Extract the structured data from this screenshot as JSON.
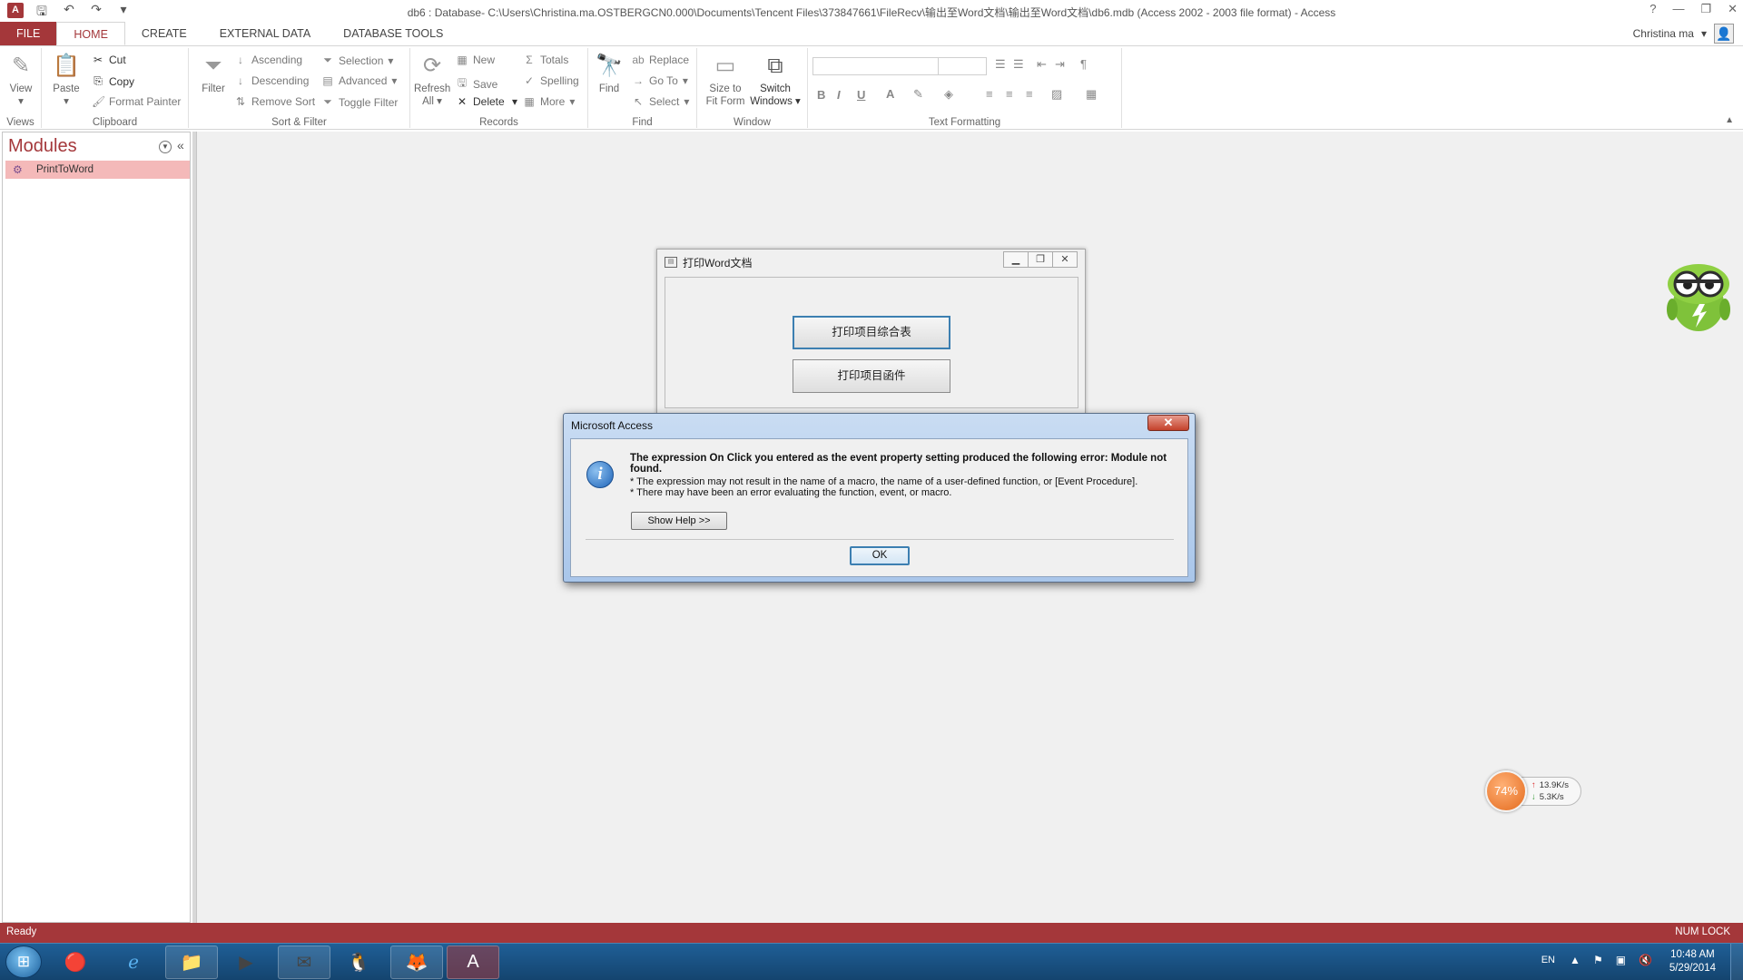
{
  "titlebar": {
    "app_icon": "A",
    "title": "db6 : Database- C:\\Users\\Christina.ma.OSTBERGCN0.000\\Documents\\Tencent Files\\373847661\\FileRecv\\输出至Word文档\\输出至Word文档\\db6.mdb (Access 2002 - 2003 file format) - Access",
    "help": "?",
    "minimize": "—",
    "restore": "❐",
    "close": "✕"
  },
  "tabs": [
    "FILE",
    "HOME",
    "CREATE",
    "EXTERNAL DATA",
    "DATABASE TOOLS"
  ],
  "user": {
    "name": "Christina ma"
  },
  "ribbon": {
    "views": {
      "label": "Views",
      "view": "View"
    },
    "clipboard": {
      "label": "Clipboard",
      "paste": "Paste",
      "cut": "Cut",
      "copy": "Copy",
      "format_painter": "Format Painter"
    },
    "sort_filter": {
      "label": "Sort & Filter",
      "filter": "Filter",
      "ascending": "Ascending",
      "descending": "Descending",
      "remove_sort": "Remove Sort",
      "selection": "Selection",
      "advanced": "Advanced",
      "toggle_filter": "Toggle Filter"
    },
    "records": {
      "label": "Records",
      "refresh": "Refresh",
      "refresh2": "All",
      "new": "New",
      "save": "Save",
      "delete": "Delete",
      "totals": "Totals",
      "spelling": "Spelling",
      "more": "More"
    },
    "find": {
      "label": "Find",
      "find": "Find",
      "replace": "Replace",
      "goto": "Go To",
      "select": "Select"
    },
    "window": {
      "label": "Window",
      "size_to_fit": "Size to",
      "size_to_fit2": "Fit Form",
      "switch": "Switch",
      "switch2": "Windows"
    },
    "text_formatting": {
      "label": "Text Formatting",
      "bold": "B",
      "italic": "I",
      "underline": "U"
    }
  },
  "navpane": {
    "title": "Modules",
    "items": [
      {
        "label": "PrintToWord"
      }
    ]
  },
  "form": {
    "title": "打印Word文档",
    "button1": "打印项目综合表",
    "button2": "打印项目函件"
  },
  "msgbox": {
    "title": "Microsoft Access",
    "close": "✕",
    "main": "The expression On Click you entered as the event property setting produced the following error: Module not found.",
    "line1": "* The expression may not result in the name of a macro, the name of a user-defined function, or [Event Procedure].",
    "line2": "* There may have been an error evaluating the function, event, or macro.",
    "help_button": "Show Help >>",
    "ok_button": "OK"
  },
  "netmon": {
    "percent": "74%",
    "up": "13.9K/s",
    "down": "5.3K/s"
  },
  "status": {
    "left": "Ready",
    "right": "NUM LOCK"
  },
  "taskbar": {
    "lang": "EN",
    "time": "10:48 AM",
    "date": "5/29/2014"
  },
  "colors": {
    "accent": "#a4373a",
    "workspace": "#f0f0f0",
    "taskbar": "#1a5080"
  }
}
